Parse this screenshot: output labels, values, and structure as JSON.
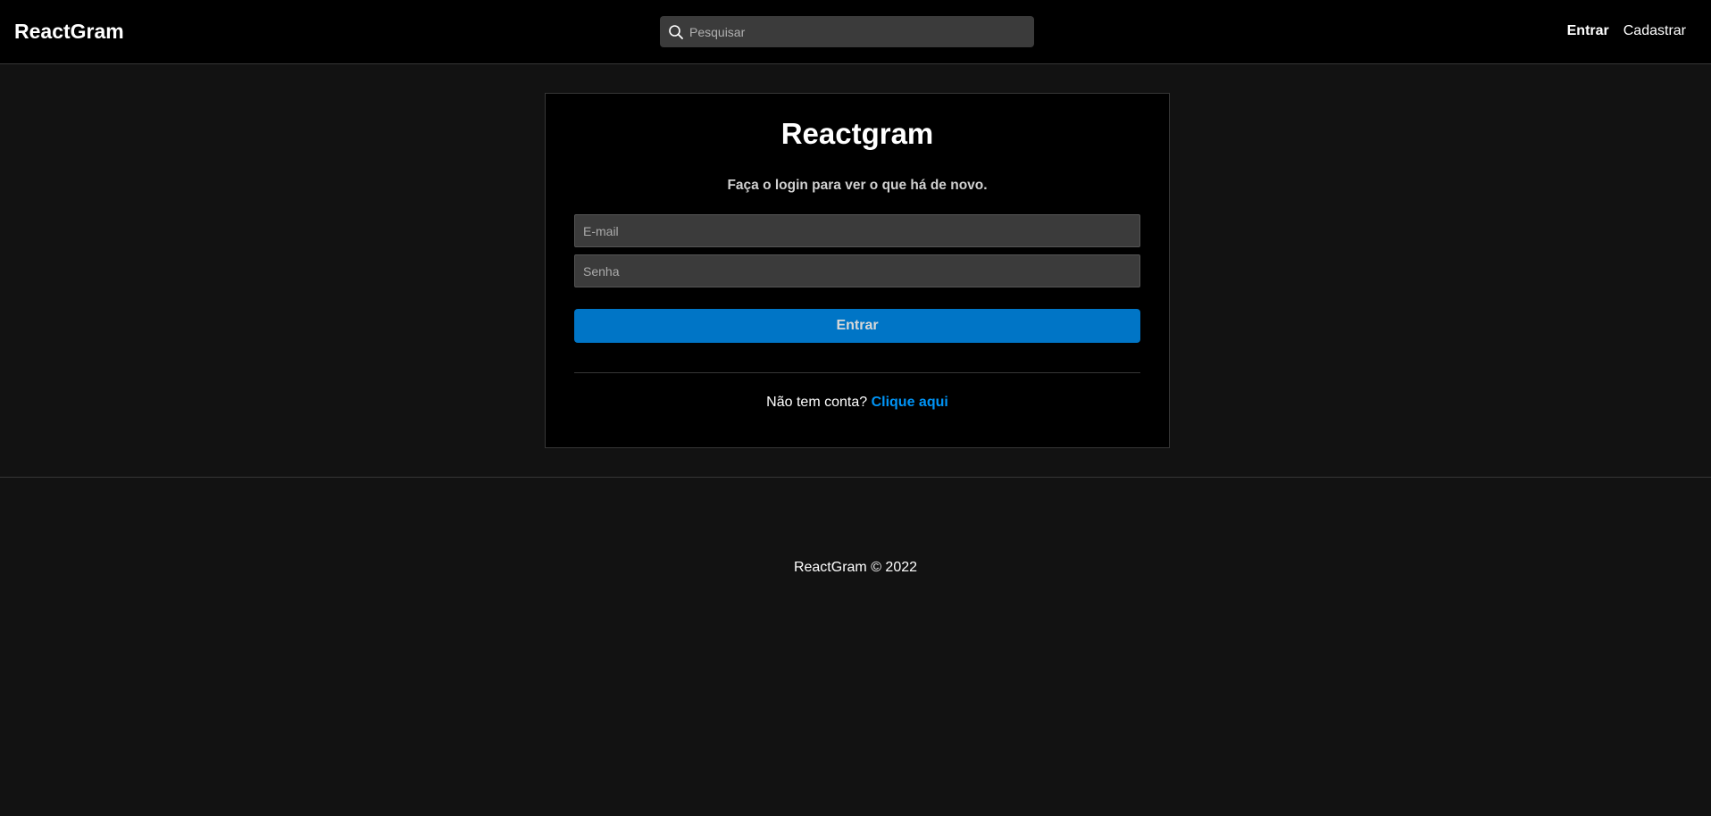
{
  "navbar": {
    "brand": "ReactGram",
    "search": {
      "placeholder": "Pesquisar",
      "value": "",
      "icon": "search-icon"
    },
    "links": {
      "login": "Entrar",
      "register": "Cadastrar"
    }
  },
  "login": {
    "title": "Reactgram",
    "subtitle": "Faça o login para ver o que há de novo.",
    "email_placeholder": "E-mail",
    "password_placeholder": "Senha",
    "submit_label": "Entrar",
    "signup_prompt": "Não tem conta?",
    "signup_link": "Clique aqui"
  },
  "footer": {
    "text": "ReactGram © 2022"
  },
  "colors": {
    "page_bg": "#121212",
    "navbar_bg": "#000000",
    "card_bg": "#000000",
    "input_bg": "#3b3b3b",
    "button_bg": "#0075c6",
    "link_color": "#0094f6",
    "border": "#363636"
  }
}
